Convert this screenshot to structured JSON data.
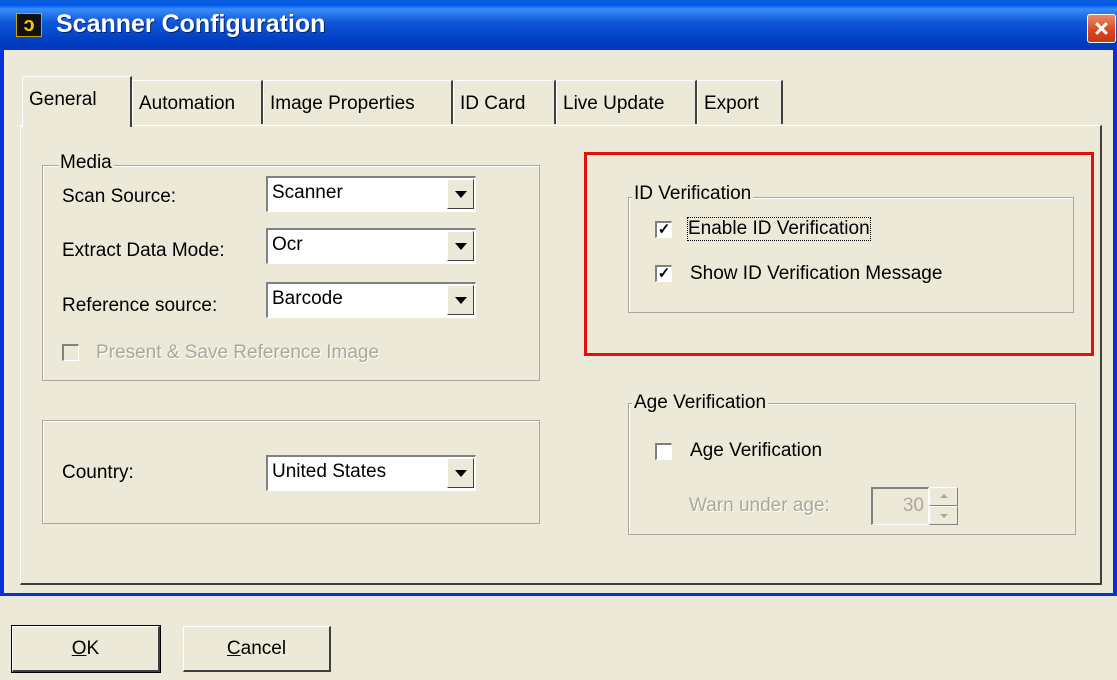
{
  "window": {
    "title": "Scanner Configuration",
    "icon": "app-logo-icon"
  },
  "tabs": [
    {
      "label": "General",
      "active": true
    },
    {
      "label": "Automation"
    },
    {
      "label": "Image Properties"
    },
    {
      "label": "ID Card"
    },
    {
      "label": "Live Update"
    },
    {
      "label": "Export"
    }
  ],
  "media": {
    "legend": "Media",
    "scan_source_label": "Scan Source:",
    "scan_source_value": "Scanner",
    "extract_mode_label": "Extract Data Mode:",
    "extract_mode_value": "Ocr",
    "reference_source_label": "Reference source:",
    "reference_source_value": "Barcode",
    "present_save_label": "Present & Save  Reference Image"
  },
  "country": {
    "label": "Country:",
    "value": "United States"
  },
  "id_verification": {
    "legend": "ID Verification",
    "enable_label": "Enable ID Verification",
    "enable_checked": true,
    "show_message_label": "Show ID Verification Message",
    "show_message_checked": true
  },
  "age_verification": {
    "legend": "Age Verification",
    "checkbox_label": "Age Verification",
    "checked": false,
    "warn_label": "Warn under age:",
    "warn_value": "30"
  },
  "buttons": {
    "ok_mnemonic": "O",
    "ok_rest": "K",
    "cancel_mnemonic": "C",
    "cancel_rest": "ancel"
  },
  "colors": {
    "title_bar": "#0058ee",
    "face": "#ece9d8",
    "highlight_box": "#e01010",
    "close_button": "#d9441e"
  }
}
